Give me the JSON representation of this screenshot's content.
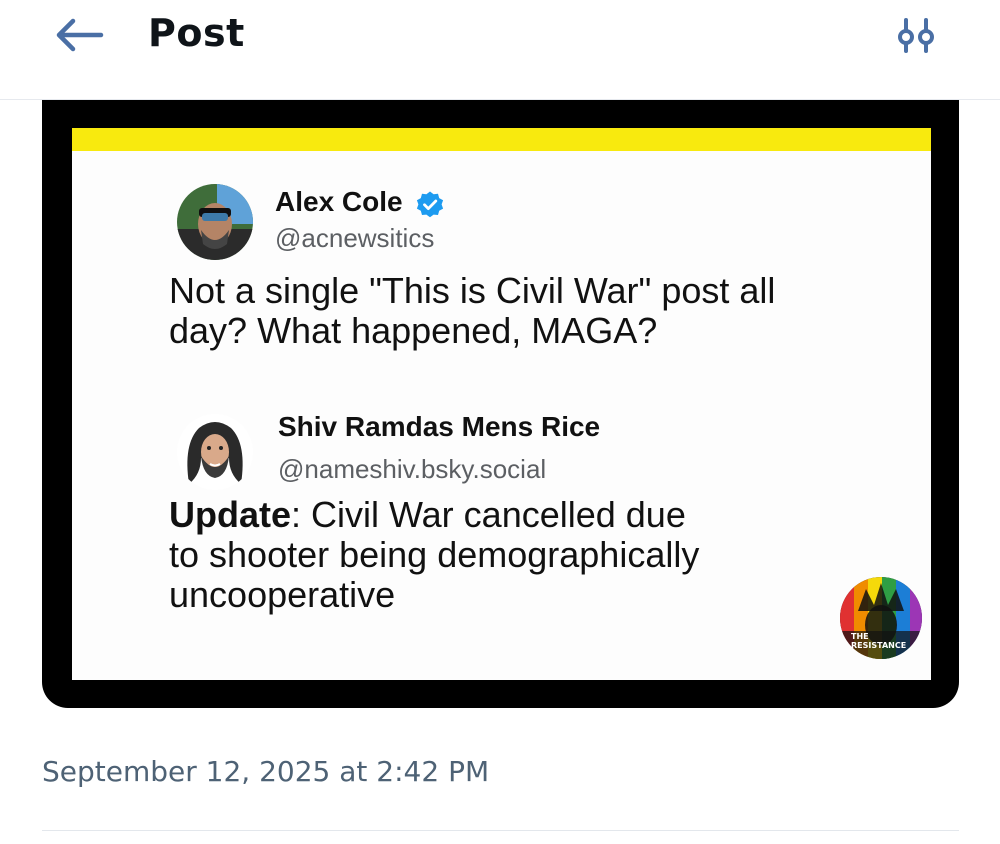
{
  "header": {
    "title": "Post",
    "back_icon": "back-arrow-icon",
    "filter_icon": "sliders-icon",
    "accent_color": "#4a6fa5"
  },
  "embedded_image": {
    "banner_color": "#f8ea0e",
    "tweet_1": {
      "name": "Alex Cole",
      "verified": true,
      "verified_color": "#1d9bf0",
      "handle": "@acnewsitics",
      "text_lines": [
        "Not a single \"This is Civil War\" post all",
        "day? What happened, MAGA?"
      ]
    },
    "tweet_2": {
      "name": "Shiv Ramdas Mens Rice",
      "handle": "@nameshiv.bsky.social",
      "text_bold": "Update",
      "text_rest": ": Civil War cancelled due",
      "text_lines": [
        "to shooter being demographically",
        "uncooperative"
      ]
    },
    "watermark": {
      "line1": "THE",
      "line2": "RESISTANCE"
    }
  },
  "timestamp": "September 12, 2025 at 2:42 PM"
}
